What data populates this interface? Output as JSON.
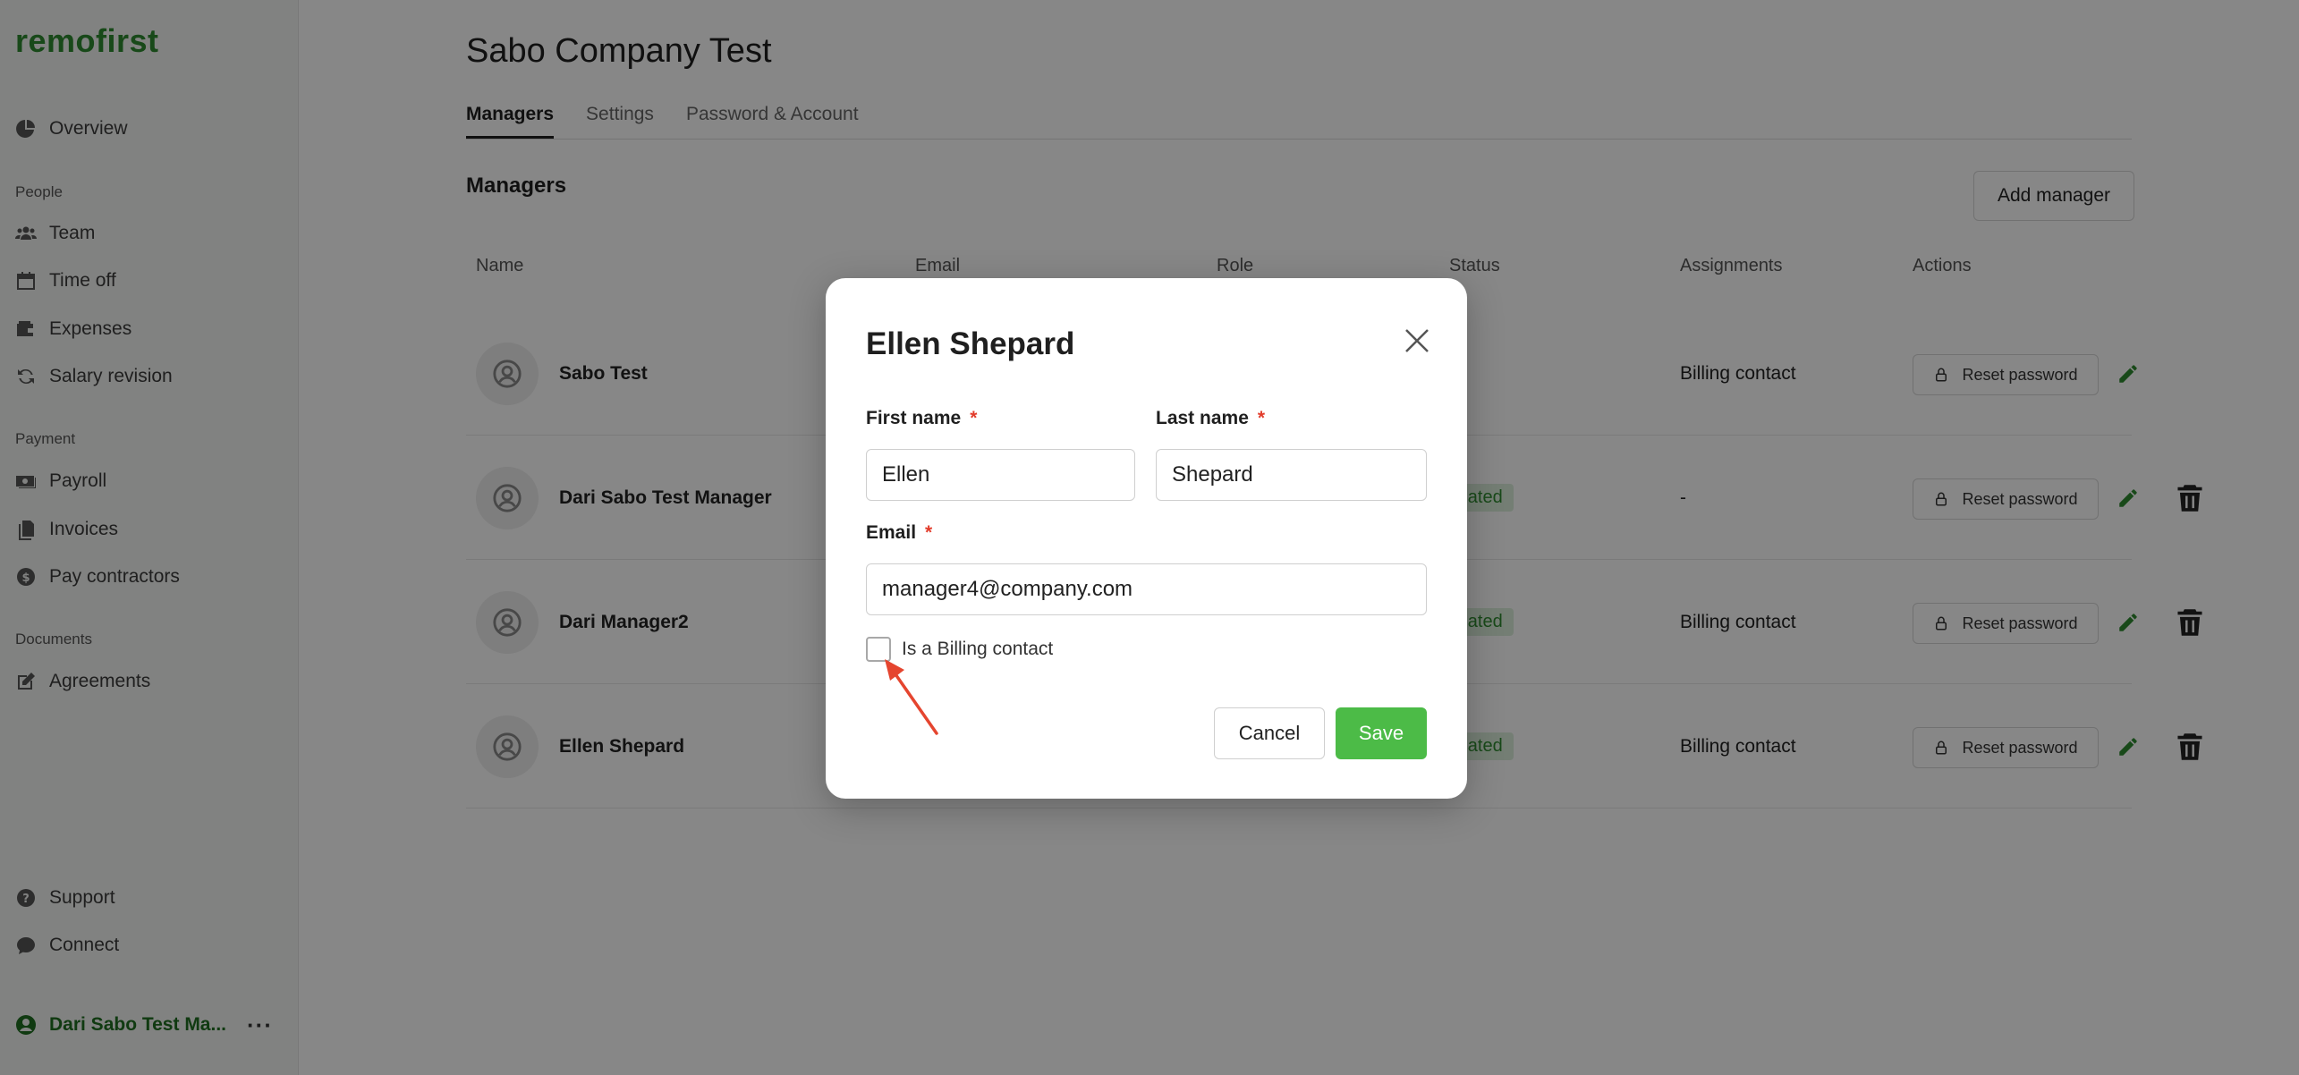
{
  "sidebar": {
    "logo": "remofirst",
    "items": [
      {
        "label": "Overview",
        "icon": "pie-chart-icon"
      },
      {
        "label": "Team",
        "icon": "team-icon"
      },
      {
        "label": "Time off",
        "icon": "calendar-icon"
      },
      {
        "label": "Expenses",
        "icon": "wallet-icon"
      },
      {
        "label": "Salary revision",
        "icon": "refresh-icon"
      },
      {
        "label": "Payroll",
        "icon": "payroll-icon"
      },
      {
        "label": "Invoices",
        "icon": "documents-icon"
      },
      {
        "label": "Pay contractors",
        "icon": "dollar-icon"
      },
      {
        "label": "Agreements",
        "icon": "edit-doc-icon"
      },
      {
        "label": "Support",
        "icon": "help-icon"
      },
      {
        "label": "Connect",
        "icon": "chat-icon"
      }
    ],
    "sections": {
      "people": "People",
      "payment": "Payment",
      "documents": "Documents"
    },
    "user": {
      "name": "Dari Sabo Test Ma...",
      "more": "···"
    }
  },
  "main": {
    "company_title": "Sabo Company Test",
    "tabs": [
      {
        "label": "Managers",
        "active": true
      },
      {
        "label": "Settings",
        "active": false
      },
      {
        "label": "Password & Account",
        "active": false
      }
    ],
    "section_title": "Managers",
    "add_manager_label": "Add manager",
    "columns": [
      "Name",
      "Email",
      "Role",
      "Status",
      "Assignments",
      "Actions"
    ],
    "rows": [
      {
        "name": "Sabo Test",
        "status": "",
        "assignment": "Billing contact",
        "reset": "Reset password",
        "deletable": false
      },
      {
        "name": "Dari Sabo Test Manager",
        "status": "reated",
        "assignment": "-",
        "reset": "Reset password",
        "deletable": true
      },
      {
        "name": "Dari Manager2",
        "status": "reated",
        "assignment": "Billing contact",
        "reset": "Reset password",
        "deletable": true
      },
      {
        "name": "Ellen Shepard",
        "status": "reated",
        "assignment": "Billing contact",
        "reset": "Reset password",
        "deletable": true
      }
    ]
  },
  "modal": {
    "title": "Ellen Shepard",
    "first_name_label": "First name",
    "last_name_label": "Last name",
    "email_label": "Email",
    "required_mark": "*",
    "first_name_value": "Ellen",
    "last_name_value": "Shepard",
    "email_value": "manager4@company.com",
    "billing_checkbox_label": "Is a Billing contact",
    "billing_checked": false,
    "cancel_label": "Cancel",
    "save_label": "Save"
  },
  "colors": {
    "brand_green": "#2e8a30",
    "save_green": "#4cbb47",
    "required_red": "#e23c2b",
    "annotation_red": "#e5452f"
  }
}
